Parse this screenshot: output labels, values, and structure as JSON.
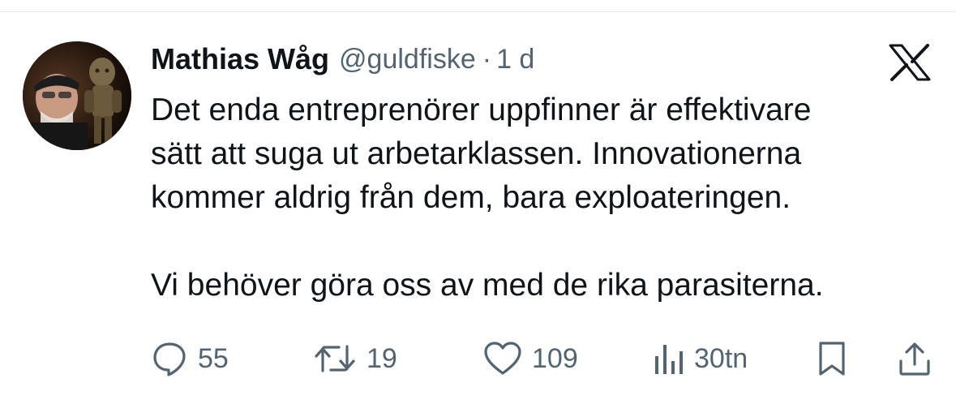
{
  "tweet": {
    "author": {
      "display_name": "Mathias Wåg",
      "handle": "@guldfiske",
      "separator": "·",
      "time": "1 d"
    },
    "platform_icon": "x-logo-icon",
    "text": "Det enda entreprenörer uppfinner är effektivare sätt att suga ut arbetarklassen. Innovationerna kommer aldrig från dem, bara exploateringen.\n\nVi behöver göra oss av med de rika parasiterna.",
    "text_lines": [
      "Det enda entreprenörer uppfinner är effektivare",
      "sätt att suga ut arbetarklassen. Innovationerna",
      "kommer aldrig från dem, bara exploateringen.",
      "",
      "Vi behöver göra oss av med de rika parasiterna."
    ],
    "actions": {
      "replies": "55",
      "reposts": "19",
      "likes": "109",
      "views": "30tn"
    },
    "icons": {
      "reply": "reply-bubble-icon",
      "repost": "repost-arrows-icon",
      "like": "heart-icon",
      "views": "views-bar-chart-icon",
      "bookmark": "bookmark-icon",
      "share": "share-upload-icon"
    }
  },
  "colors": {
    "text_primary": "#0f1419",
    "text_secondary": "#536471",
    "divider": "#e6e9ec",
    "background": "#ffffff"
  }
}
